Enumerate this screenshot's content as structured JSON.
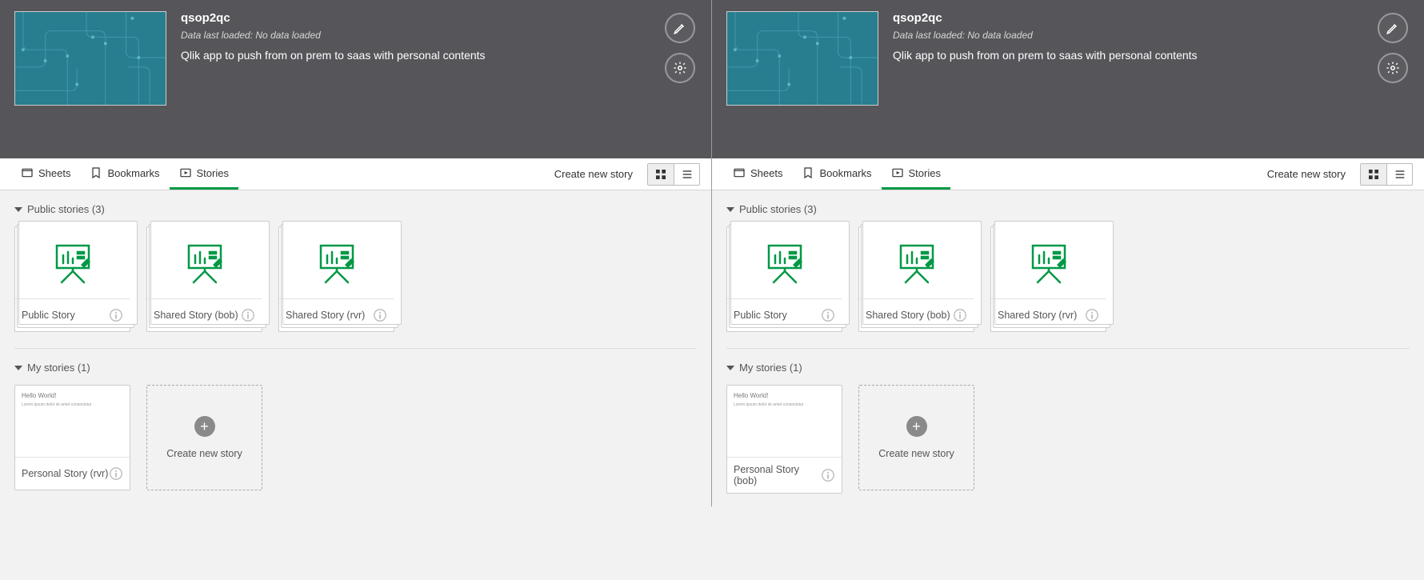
{
  "panes": [
    {
      "app": {
        "title": "qsop2qc",
        "subtitle": "Data last loaded: No data loaded",
        "description": "Qlik app to push from on prem to saas with personal contents"
      },
      "tabs": {
        "sheets": "Sheets",
        "bookmarks": "Bookmarks",
        "stories": "Stories"
      },
      "actions": {
        "create_new_story": "Create new story"
      },
      "sections": {
        "public": {
          "title": "Public stories (3)"
        },
        "my": {
          "title": "My stories (1)"
        }
      },
      "public_stories": [
        {
          "label": "Public Story"
        },
        {
          "label": "Shared Story (bob)"
        },
        {
          "label": "Shared Story (rvr)"
        }
      ],
      "my_stories": [
        {
          "label": "Personal Story (rvr)",
          "slide_title": "Hello World!",
          "slide_body": "Lorem ipsum dolor sit\namet consectetur"
        }
      ],
      "create_card": "Create new story"
    },
    {
      "app": {
        "title": "qsop2qc",
        "subtitle": "Data last loaded: No data loaded",
        "description": "Qlik app to push from on prem to saas with personal contents"
      },
      "tabs": {
        "sheets": "Sheets",
        "bookmarks": "Bookmarks",
        "stories": "Stories"
      },
      "actions": {
        "create_new_story": "Create new story"
      },
      "sections": {
        "public": {
          "title": "Public stories (3)"
        },
        "my": {
          "title": "My stories (1)"
        }
      },
      "public_stories": [
        {
          "label": "Public Story"
        },
        {
          "label": "Shared Story (bob)"
        },
        {
          "label": "Shared Story (rvr)"
        }
      ],
      "my_stories": [
        {
          "label": "Personal Story (bob)",
          "slide_title": "Hello World!",
          "slide_body": "Lorem ipsum dolor sit\namet consectetur"
        }
      ],
      "create_card": "Create new story"
    }
  ]
}
